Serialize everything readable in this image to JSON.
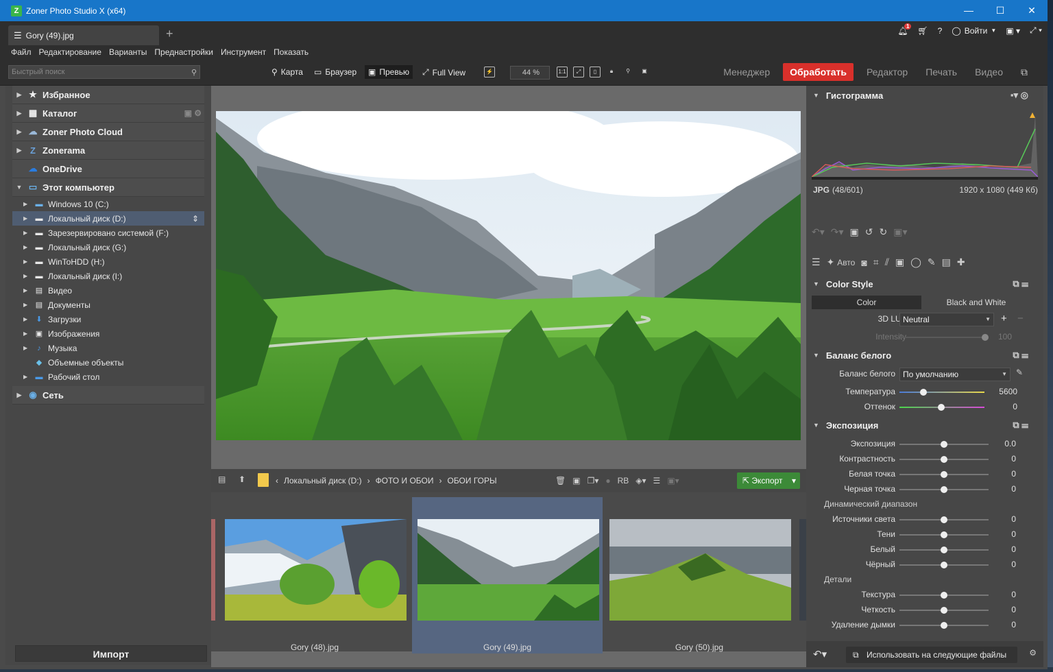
{
  "window": {
    "title": "Zoner Photo Studio X (x64)",
    "logo": "Z",
    "minimize": "—",
    "maximize": "☐",
    "close": "✕"
  },
  "tab": {
    "label": "Gory (49).jpg",
    "new_tab": "+"
  },
  "header_right": {
    "notifications": "1",
    "login": "Войти"
  },
  "menu": [
    "Файл",
    "Редактирование",
    "Варианты",
    "Преднастройки",
    "Инструмент",
    "Показать"
  ],
  "toolbar": {
    "search_placeholder": "Быстрый поиск",
    "map": "Карта",
    "browser": "Браузер",
    "preview": "Превью",
    "fullview": "Full View",
    "zoom": "44 %",
    "modes": {
      "manager": "Менеджер",
      "process": "Обработать",
      "editor": "Редактор",
      "print": "Печать",
      "video": "Видео"
    }
  },
  "tree": {
    "favorites": "Избранное",
    "catalog": "Каталог",
    "cloud": "Zoner Photo Cloud",
    "zonerama": "Zonerama",
    "onedrive": "OneDrive",
    "computer": "Этот компьютер",
    "drives": [
      {
        "label": "Windows 10 (C:)",
        "icon": "drive-icon"
      },
      {
        "label": "Локальный диск (D:)",
        "icon": "drive-icon",
        "selected": true
      },
      {
        "label": "Зарезервировано системой (F:)",
        "icon": "drive-icon"
      },
      {
        "label": "Локальный диск (G:)",
        "icon": "drive-icon"
      },
      {
        "label": "WinToHDD (H:)",
        "icon": "drive-icon"
      },
      {
        "label": "Локальный диск (I:)",
        "icon": "drive-icon"
      },
      {
        "label": "Видео",
        "icon": "video-folder-icon"
      },
      {
        "label": "Документы",
        "icon": "documents-icon"
      },
      {
        "label": "Загрузки",
        "icon": "downloads-icon"
      },
      {
        "label": "Изображения",
        "icon": "pictures-icon"
      },
      {
        "label": "Музыка",
        "icon": "music-icon"
      },
      {
        "label": "Объемные объекты",
        "icon": "3d-objects-icon"
      },
      {
        "label": "Рабочий стол",
        "icon": "desktop-icon"
      }
    ],
    "network": "Сеть",
    "import": "Импорт"
  },
  "breadcrumb": {
    "drive": "Локальный диск (D:)",
    "folder1": "ФОТО И ОБОИ",
    "folder2": "ОБОИ ГОРЫ",
    "export": "Экспорт"
  },
  "thumbs": [
    {
      "caption": "Gory (48).jpg"
    },
    {
      "caption": "Gory (49).jpg",
      "selected": true
    },
    {
      "caption": "Gory (50).jpg"
    }
  ],
  "right": {
    "histogram_title": "Гистограмма",
    "file_type": "JPG",
    "file_index": "(48/601)",
    "file_dims": "1920 x 1080 (449 Кб)",
    "auto": "Авто",
    "color_style": {
      "title": "Color Style",
      "tab_color": "Color",
      "tab_bw": "Black and White",
      "lut_label": "3D LUT",
      "lut_value": "Neutral",
      "intensity_label": "Intensity",
      "intensity_value": "100"
    },
    "wb": {
      "title": "Баланс белого",
      "label": "Баланс белого",
      "value": "По умолчанию",
      "temp_label": "Температура",
      "temp_value": "5600",
      "tint_label": "Оттенок",
      "tint_value": "0"
    },
    "exposure": {
      "title": "Экспозиция",
      "rows": [
        {
          "label": "Экспозиция",
          "value": "0.0"
        },
        {
          "label": "Контрастность",
          "value": "0"
        },
        {
          "label": "Белая точка",
          "value": "0"
        },
        {
          "label": "Черная точка",
          "value": "0"
        }
      ],
      "dynamic_label": "Динамический диапазон",
      "dyn_rows": [
        {
          "label": "Источники света",
          "value": "0"
        },
        {
          "label": "Тени",
          "value": "0"
        },
        {
          "label": "Белый",
          "value": "0"
        },
        {
          "label": "Чёрный",
          "value": "0"
        }
      ],
      "details_label": "Детали",
      "detail_rows": [
        {
          "label": "Текстура",
          "value": "0"
        },
        {
          "label": "Четкость",
          "value": "0"
        },
        {
          "label": "Удаление дымки",
          "value": "0"
        }
      ]
    },
    "use_next": "Использовать на следующие файлы"
  },
  "colors": {
    "process": "#d9302b",
    "titlebar": "#1876c9",
    "export": "#3c8a38",
    "selection": "#566681"
  }
}
